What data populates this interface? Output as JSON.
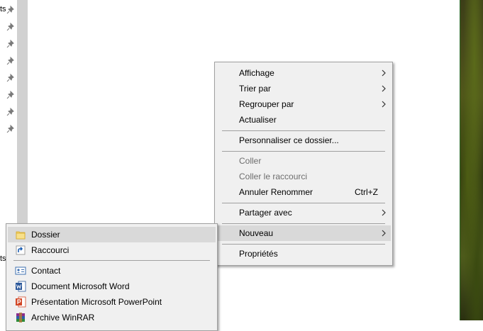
{
  "nav_pane": {
    "fragments": [
      "ts",
      "ts"
    ],
    "pin_icon": "pin-icon",
    "pin_count": 8
  },
  "context_menu": {
    "items": [
      {
        "label": "Affichage",
        "submenu": true
      },
      {
        "label": "Trier par",
        "submenu": true
      },
      {
        "label": "Regrouper par",
        "submenu": true
      },
      {
        "label": "Actualiser"
      },
      {
        "label": "Personnaliser ce dossier..."
      },
      {
        "label": "Coller",
        "disabled": true
      },
      {
        "label": "Coller le raccourci",
        "disabled": true
      },
      {
        "label": "Annuler Renommer",
        "shortcut": "Ctrl+Z"
      },
      {
        "label": "Partager avec",
        "submenu": true
      },
      {
        "label": "Nouveau",
        "submenu": true,
        "highlighted": true
      },
      {
        "label": "Propriétés"
      }
    ]
  },
  "new_submenu": {
    "items": [
      {
        "label": "Dossier",
        "icon": "folder-icon",
        "highlighted": true
      },
      {
        "label": "Raccourci",
        "icon": "shortcut-icon"
      },
      {
        "label": "Contact",
        "icon": "contact-icon"
      },
      {
        "label": "Document Microsoft Word",
        "icon": "word-document-icon"
      },
      {
        "label": "Présentation Microsoft PowerPoint",
        "icon": "powerpoint-icon"
      },
      {
        "label": "Archive WinRAR",
        "icon": "winrar-icon"
      }
    ]
  },
  "colors": {
    "menu_bg": "#f0f0f0",
    "menu_hover": "#d9d9d9",
    "disabled_text": "#6d6d6d",
    "scrollbar": "#d1d1d1"
  }
}
